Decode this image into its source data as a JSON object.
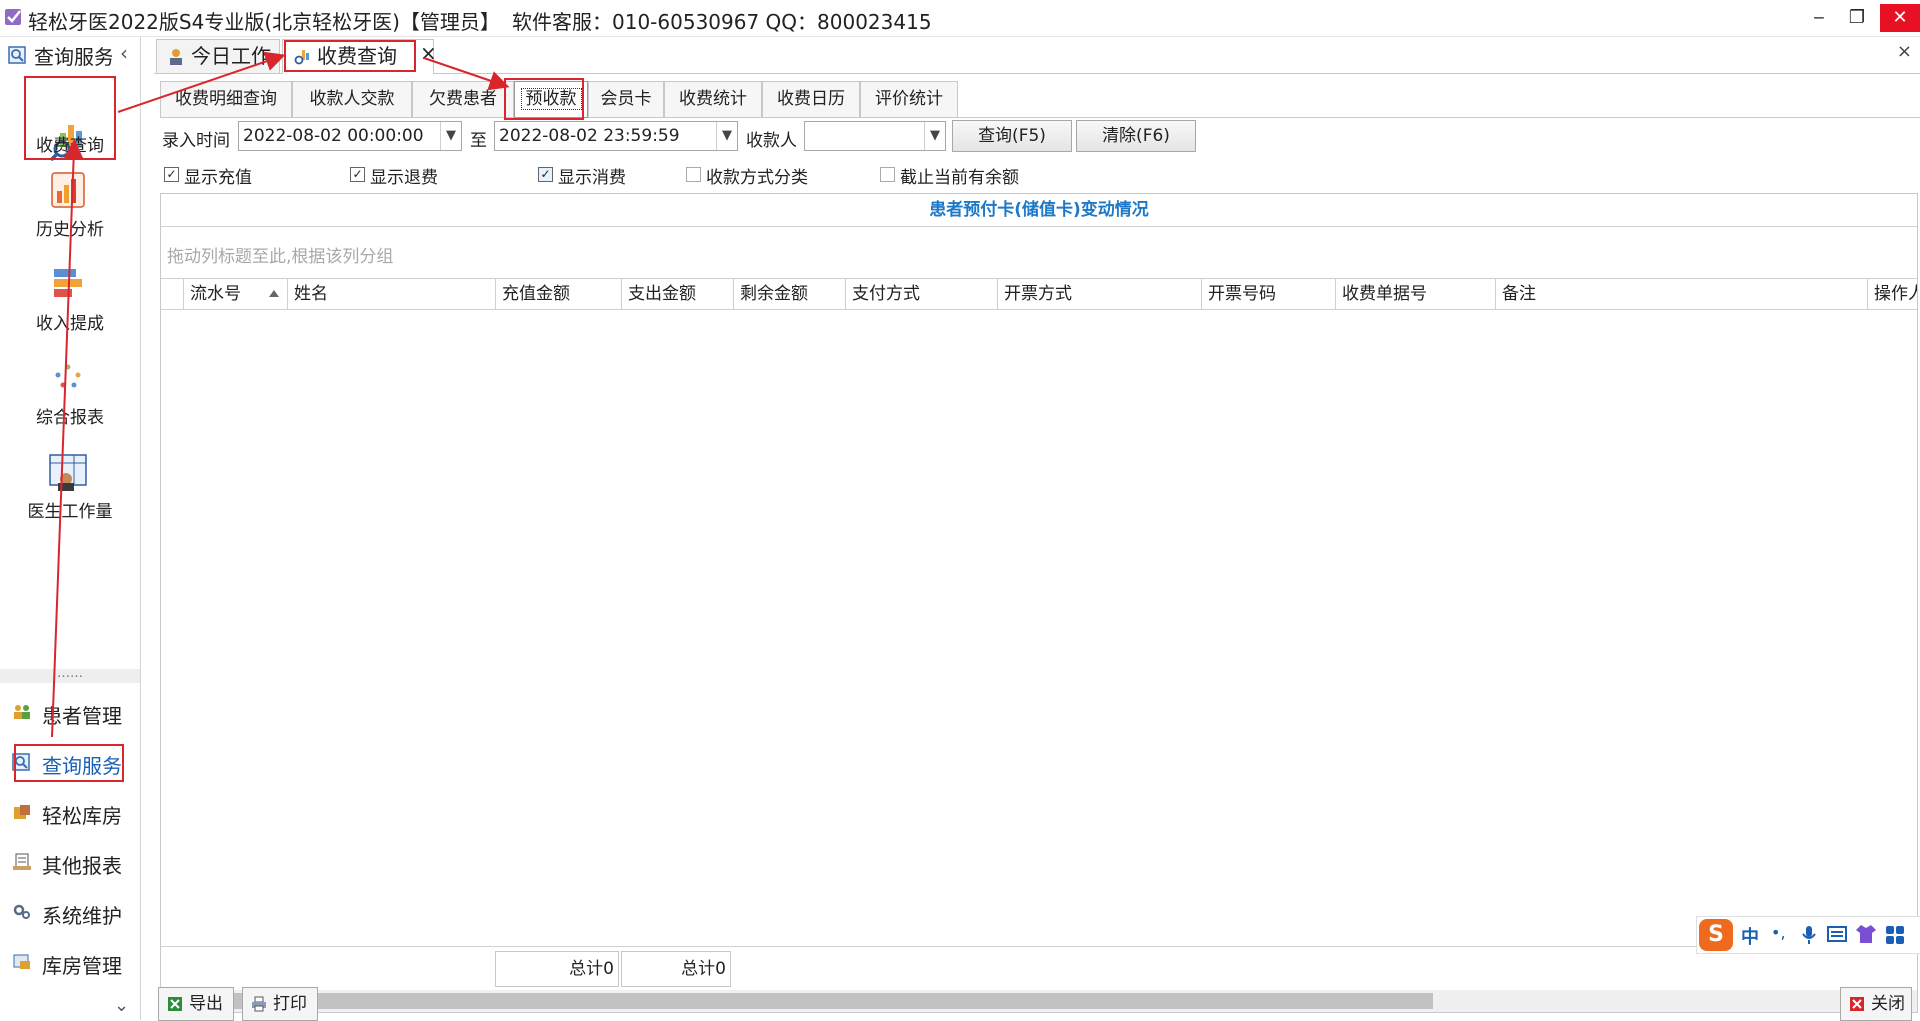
{
  "window": {
    "title": "轻松牙医2022版S4专业版(北京轻松牙医)【管理员】",
    "support": "软件客服：010-60530967 QQ：800023415",
    "min_glyph": "‒",
    "restore_glyph": "❐",
    "close_glyph": "✕"
  },
  "sidebar": {
    "header": "查询服务",
    "collapse_glyph": "‹",
    "tools": [
      {
        "label": "收费查询",
        "icon": "charge-query-icon"
      },
      {
        "label": "历史分析",
        "icon": "history-analysis-icon"
      },
      {
        "label": "收入提成",
        "icon": "income-commission-icon"
      },
      {
        "label": "综合报表",
        "icon": "comprehensive-report-icon"
      },
      {
        "label": "医生工作量",
        "icon": "doctor-workload-icon"
      }
    ],
    "divider": "……",
    "nav": [
      {
        "label": "患者管理",
        "icon": "patients-icon"
      },
      {
        "label": "查询服务",
        "icon": "query-service-icon"
      },
      {
        "label": "轻松库房",
        "icon": "warehouse-icon"
      },
      {
        "label": "其他报表",
        "icon": "other-report-icon"
      },
      {
        "label": "系统维护",
        "icon": "system-maintenance-icon"
      },
      {
        "label": "库房管理",
        "icon": "warehouse-manage-icon"
      }
    ],
    "more_glyph": "⌄"
  },
  "main_tabs": [
    {
      "label": "今日工作"
    },
    {
      "label": "收费查询"
    }
  ],
  "main_tab_close": "×",
  "main_close": "×",
  "sub_tabs": [
    "收费明细查询",
    "收款人交款",
    "欠费患者",
    "预收款",
    "会员卡",
    "收费统计",
    "收费日历",
    "评价统计"
  ],
  "filters": {
    "time_label": "录入时间",
    "start": "2022-08-02 00:00:00",
    "to_label": "至",
    "end": "2022-08-02 23:59:59",
    "payee_label": "收款人",
    "payee_value": "",
    "query_btn": "查询(F5)",
    "clear_btn": "清除(F6)"
  },
  "checkboxes": [
    {
      "label": "显示充值",
      "checked": true
    },
    {
      "label": "显示退费",
      "checked": true
    },
    {
      "label": "显示消费",
      "checked": true
    },
    {
      "label": "收款方式分类",
      "checked": false
    },
    {
      "label": "截止当前有余额",
      "checked": false
    }
  ],
  "check_glyph": "✓",
  "grid": {
    "title": "患者预付卡(储值卡)变动情况",
    "group_hint": "拖动列标题至此,根据该列分组",
    "columns": [
      "流水号",
      "姓名",
      "充值金额",
      "支出金额",
      "剩余金额",
      "支付方式",
      "开票方式",
      "开票号码",
      "收费单据号",
      "备注",
      "操作人"
    ],
    "totals": [
      "总计0",
      "总计0"
    ]
  },
  "scroll": {
    "left": "‹",
    "right": "›"
  },
  "bottom_buttons": [
    "导出",
    "打印"
  ],
  "close_button": "关闭",
  "ime": {
    "s": "S",
    "zh": "中",
    "dot": "•,"
  }
}
